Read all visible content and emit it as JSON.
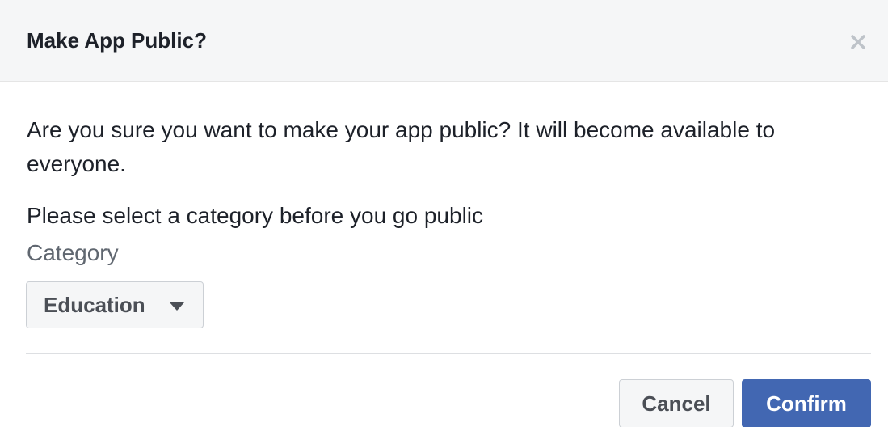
{
  "dialog": {
    "title": "Make App Public?",
    "close_icon": "close-icon",
    "message": "Are you sure you want to make your app public? It will become available to everyone.",
    "instruction": "Please select a category before you go public",
    "category_label": "Category",
    "category_select": {
      "selected": "Education",
      "caret_icon": "caret-down-icon"
    },
    "buttons": {
      "cancel_label": "Cancel",
      "confirm_label": "Confirm"
    }
  },
  "colors": {
    "header_background": "#f5f6f7",
    "primary_button": "#4267b2",
    "text_primary": "#1d2129",
    "text_secondary": "#606770"
  }
}
